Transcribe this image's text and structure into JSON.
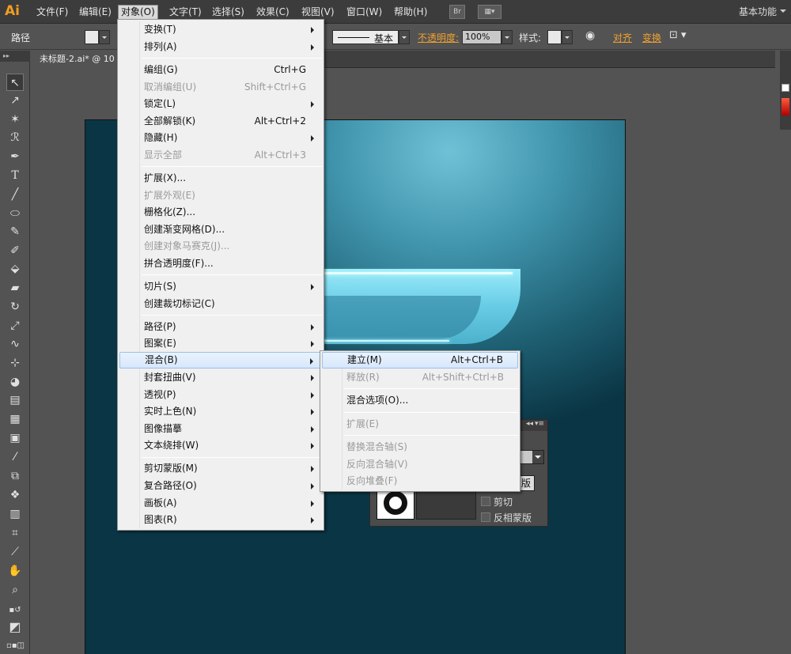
{
  "menubar": {
    "logo": "Ai",
    "items": [
      "文件(F)",
      "编辑(E)",
      "对象(O)",
      "文字(T)",
      "选择(S)",
      "效果(C)",
      "视图(V)",
      "窗口(W)",
      "帮助(H)"
    ],
    "bridge_label": "Br",
    "workspace": "基本功能"
  },
  "controlbar": {
    "title": "路径",
    "stroke_style": "基本",
    "opacity_label": "不透明度:",
    "opacity_value": "100%",
    "style_label": "样式:",
    "align_label": "对齐",
    "transform_label": "变换"
  },
  "document": {
    "tab_title": "未标题-2.ai* @ 10"
  },
  "transparency_panel": {
    "button_label": "版",
    "clip_label": "剪切",
    "invert_mask_label": "反相蒙版"
  },
  "object_menu": {
    "items": [
      {
        "label": "变换(T)",
        "submenu": true
      },
      {
        "label": "排列(A)",
        "submenu": true
      },
      {
        "label": "编组(G)",
        "shortcut": "Ctrl+G"
      },
      {
        "label": "取消编组(U)",
        "shortcut": "Shift+Ctrl+G",
        "disabled": true
      },
      {
        "label": "锁定(L)",
        "submenu": true
      },
      {
        "label": "全部解锁(K)",
        "shortcut": "Alt+Ctrl+2"
      },
      {
        "label": "隐藏(H)",
        "submenu": true
      },
      {
        "label": "显示全部",
        "shortcut": "Alt+Ctrl+3",
        "disabled": true
      },
      {
        "label": "扩展(X)..."
      },
      {
        "label": "扩展外观(E)",
        "disabled": true
      },
      {
        "label": "栅格化(Z)..."
      },
      {
        "label": "创建渐变网格(D)..."
      },
      {
        "label": "创建对象马赛克(J)...",
        "disabled": true
      },
      {
        "label": "拼合透明度(F)..."
      },
      {
        "label": "切片(S)",
        "submenu": true
      },
      {
        "label": "创建裁切标记(C)"
      },
      {
        "label": "路径(P)",
        "submenu": true
      },
      {
        "label": "图案(E)",
        "submenu": true
      },
      {
        "label": "混合(B)",
        "submenu": true,
        "highlighted": true
      },
      {
        "label": "封套扭曲(V)",
        "submenu": true
      },
      {
        "label": "透视(P)",
        "submenu": true
      },
      {
        "label": "实时上色(N)",
        "submenu": true
      },
      {
        "label": "图像描摹",
        "submenu": true
      },
      {
        "label": "文本绕排(W)",
        "submenu": true
      },
      {
        "label": "剪切蒙版(M)",
        "submenu": true
      },
      {
        "label": "复合路径(O)",
        "submenu": true
      },
      {
        "label": "画板(A)",
        "submenu": true
      },
      {
        "label": "图表(R)",
        "submenu": true
      }
    ]
  },
  "blend_submenu": {
    "items": [
      {
        "label": "建立(M)",
        "shortcut": "Alt+Ctrl+B",
        "highlighted": true
      },
      {
        "label": "释放(R)",
        "shortcut": "Alt+Shift+Ctrl+B",
        "disabled": true
      },
      {
        "label": "混合选项(O)..."
      },
      {
        "label": "扩展(E)",
        "disabled": true
      },
      {
        "label": "替换混合轴(S)",
        "disabled": true
      },
      {
        "label": "反向混合轴(V)",
        "disabled": true
      },
      {
        "label": "反向堆叠(F)",
        "disabled": true
      }
    ]
  }
}
